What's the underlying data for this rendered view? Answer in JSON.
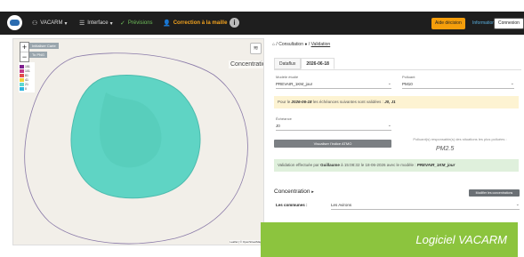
{
  "topbar": {
    "app_name": "VACARM",
    "interface_label": "Interface",
    "previsions_label": "Prévisions",
    "correction_label": "Correction à la maille",
    "info_symbol": "i",
    "aide_label": "Aide décision",
    "information_label": "Information",
    "connexion_label": "Connexion"
  },
  "map": {
    "zoom_in": "+",
    "zoom_out": "−",
    "tag1": "Initialiser Carte",
    "tag2": "To PNG",
    "layer_label": "Concentration",
    "legend": [
      {
        "label": "151",
        "color": "#7e1e8e"
      },
      {
        "label": "101",
        "color": "#c43a8a"
      },
      {
        "label": "81",
        "color": "#e24c4c"
      },
      {
        "label": "41",
        "color": "#f3d23c"
      },
      {
        "label": "21",
        "color": "#60d8d0"
      },
      {
        "label": "0",
        "color": "#2fb6e0"
      }
    ],
    "attribution": "Leaflet | © OpenStreetMap"
  },
  "breadcrumb": {
    "first": "Consultation",
    "second": "Validation"
  },
  "tabs": [
    "Dataflux",
    "2026-06-18"
  ],
  "form": {
    "modele_label": "Modèle étudié",
    "modele_value": "PREVAIR_1KM_jour",
    "polluant_label": "Polluant",
    "polluant_value": "PM10",
    "echeance_label": "Échéance",
    "echeance_value": "J0"
  },
  "alert_echeance": {
    "prefix": "Pour le",
    "date": "2026-06-18",
    "middle": "les échéances suivantes sont validées :",
    "values": "J0, J1"
  },
  "visualiser_button": "Visualiser l'indice ATMO",
  "polluant_note": "Polluant(s) responsable(s) des situations les plus polluées :",
  "polluant_result": "PM2.5",
  "alert_validation": {
    "prefix": "Validation effectuée par",
    "user": "Guillaume",
    "middle": "à 15:08:32 le 18-06-2026 avec le modèle :",
    "model": "PREVAIR_1KM_jour"
  },
  "concentration_heading": "Concentration",
  "modifier_button": "Modifier les concentrations",
  "communes": {
    "label": "Les communes :",
    "value": "Les Avirons"
  },
  "caption": "Logiciel VACARM"
}
